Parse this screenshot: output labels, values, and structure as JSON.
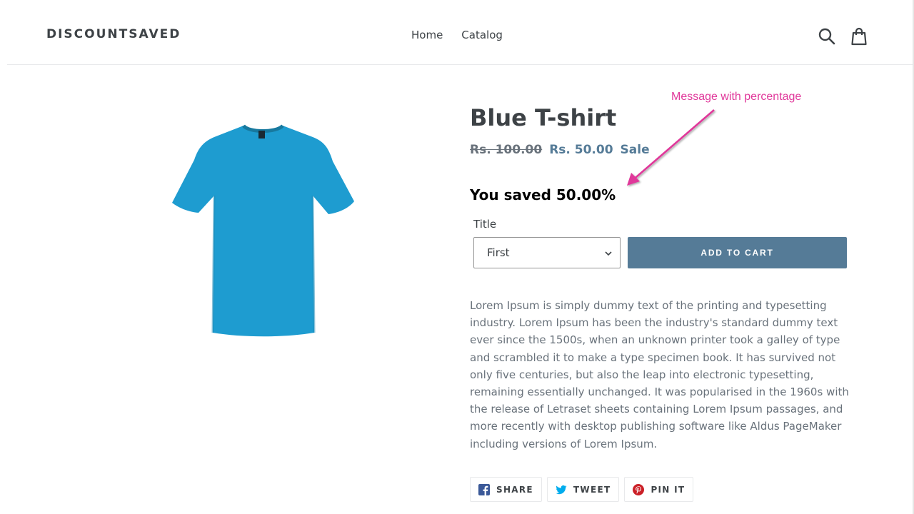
{
  "header": {
    "logo": "DISCOUNTSAVED",
    "nav": [
      {
        "label": "Home"
      },
      {
        "label": "Catalog"
      }
    ],
    "icons": [
      "search-icon",
      "cart-icon"
    ]
  },
  "product": {
    "title": "Blue T-shirt",
    "price_old": "Rs. 100.00",
    "price_new": "Rs. 50.00",
    "sale_label": "Sale",
    "saved_text": "You saved 50.00%",
    "option_label": "Title",
    "option_value": "First",
    "add_to_cart": "ADD TO CART",
    "description": "Lorem Ipsum is simply dummy text of the printing and typesetting industry. Lorem Ipsum has been the industry's standard dummy text ever since the 1500s, when an unknown printer took a galley of type and scrambled it to make a type specimen book. It has survived not only five centuries, but also the leap into electronic typesetting, remaining essentially unchanged. It was popularised in the 1960s with the release of Letraset sheets containing Lorem Ipsum passages, and more recently with desktop publishing software like Aldus PageMaker including versions of Lorem Ipsum.",
    "tshirt_color": "#1e9cd0"
  },
  "annotation": {
    "text": "Message with percentage",
    "color": "#e0379a"
  },
  "share": {
    "facebook": "SHARE",
    "twitter": "TWEET",
    "pinterest": "PIN IT"
  },
  "colors": {
    "accent": "#557b97",
    "text": "#3d4246",
    "muted": "#69727b"
  }
}
